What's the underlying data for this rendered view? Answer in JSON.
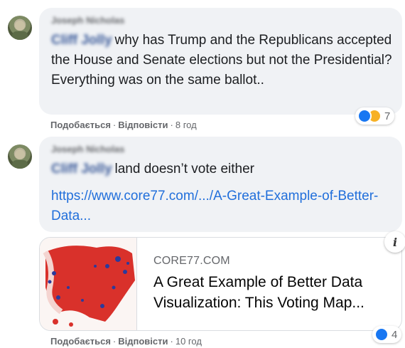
{
  "comment1": {
    "author": "Joseph Nicholas",
    "mention": "Cliff Jolly",
    "text": "why has Trump and the Republicans accepted the House and Senate elections but not the Presidential? Everything was on the same ballot..",
    "actions": {
      "like": "Подобається",
      "reply": "Відповісти",
      "time": "8 год"
    },
    "reactions": {
      "icons": [
        "like-icon",
        "haha-icon"
      ],
      "count": "7"
    }
  },
  "comment2": {
    "author": "Joseph Nicholas",
    "mention": "Cliff Jolly",
    "text": "land doesn’t vote either",
    "link": "https://www.core77.com/.../A-Great-Example-of-Better-Data...",
    "card": {
      "domain": "CORE77.COM",
      "title": "A Great Example of Better Data Visualization: This Voting Map...",
      "info_glyph": "i"
    },
    "actions": {
      "like": "Подобається",
      "reply": "Відповісти",
      "time": "10 год"
    },
    "reactions": {
      "icons": [
        "like-icon"
      ],
      "count": "4"
    }
  },
  "colors": {
    "bubble": "#f0f2f5",
    "link": "#216fdb",
    "like": "#1877f2",
    "haha": "#f7b125",
    "map_red": "#d9312b",
    "map_blue": "#2b3a9c"
  }
}
